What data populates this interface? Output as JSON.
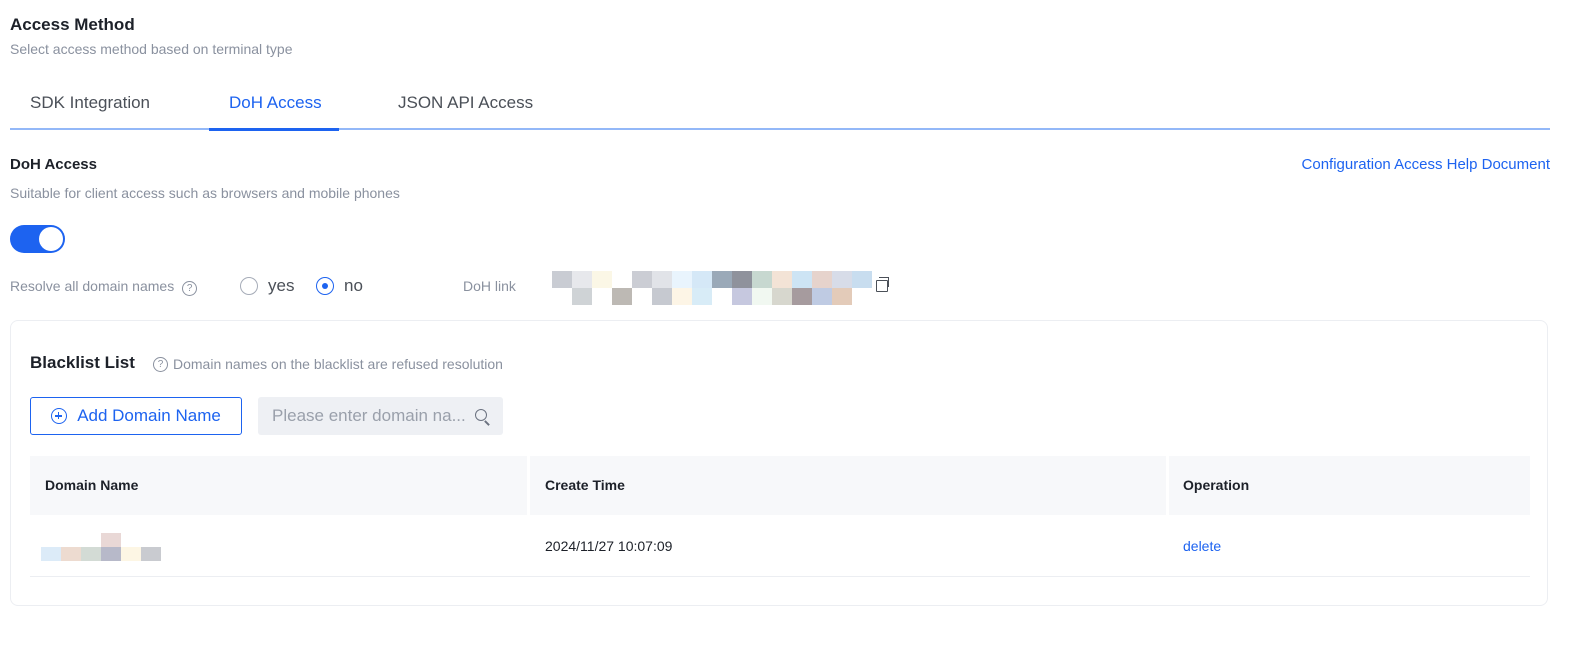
{
  "section": {
    "title": "Access Method",
    "subtitle": "Select access method based on terminal type"
  },
  "tabs": [
    {
      "label": "SDK Integration",
      "active": false
    },
    {
      "label": "DoH Access",
      "active": true
    },
    {
      "label": "JSON API Access",
      "active": false
    }
  ],
  "doh": {
    "title": "DoH Access",
    "subtitle": "Suitable for client access such as browsers and mobile phones",
    "help_link": "Configuration Access Help Document",
    "enabled": true,
    "resolve_label": "Resolve all domain names",
    "options": [
      {
        "label": "yes",
        "checked": false
      },
      {
        "label": "no",
        "checked": true
      }
    ],
    "link_label": "DoH link"
  },
  "blacklist": {
    "title": "Blacklist List",
    "hint": "Domain names on the blacklist are refused resolution",
    "add_button": "Add Domain Name",
    "search_placeholder": "Please enter domain na...",
    "columns": [
      "Domain Name",
      "Create Time",
      "Operation"
    ],
    "rows": [
      {
        "create_time": "2024/11/27 10:07:09",
        "operation": "delete"
      }
    ]
  },
  "colors": {
    "accent": "#1d63f0",
    "tab_underline": "#93b8f8",
    "muted_text": "#8a919f"
  }
}
